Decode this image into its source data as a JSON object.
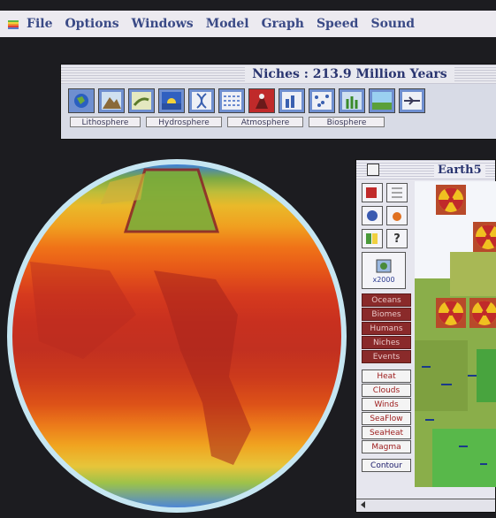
{
  "menubar": {
    "items": [
      "File",
      "Options",
      "Windows",
      "Model",
      "Graph",
      "Speed",
      "Sound"
    ]
  },
  "niches_window": {
    "title": "Niches : 213.9 Million Years",
    "tools": [
      "globe-tool-icon",
      "mountain-tool-icon",
      "lizard-tool-icon",
      "sunrise-tool-icon",
      "dna-tool-icon",
      "pattern-tool-icon",
      "volcano-tool-icon",
      "chart-tool-icon",
      "scatter-tool-icon",
      "plants-tool-icon",
      "landscape-tool-icon",
      "plane-tool-icon"
    ],
    "sphere_labels": [
      "Lithosphere",
      "Hydrosphere",
      "Atmosphere",
      "Biosphere"
    ]
  },
  "earth_window": {
    "title": "Earth5",
    "zoom_label": "x2000",
    "layer_buttons": [
      "Oceans",
      "Biomes",
      "Humans",
      "Niches",
      "Events"
    ],
    "active_buttons": [
      "Heat",
      "Clouds",
      "Winds",
      "SeaFlow",
      "SeaHeat",
      "Magma"
    ],
    "contour_label": "Contour"
  },
  "colors": {
    "menu_text": "#3a4a86",
    "globe_hot": "#c23020",
    "globe_cold": "#3d7fd8",
    "nuclear_yellow": "#f0c020"
  }
}
